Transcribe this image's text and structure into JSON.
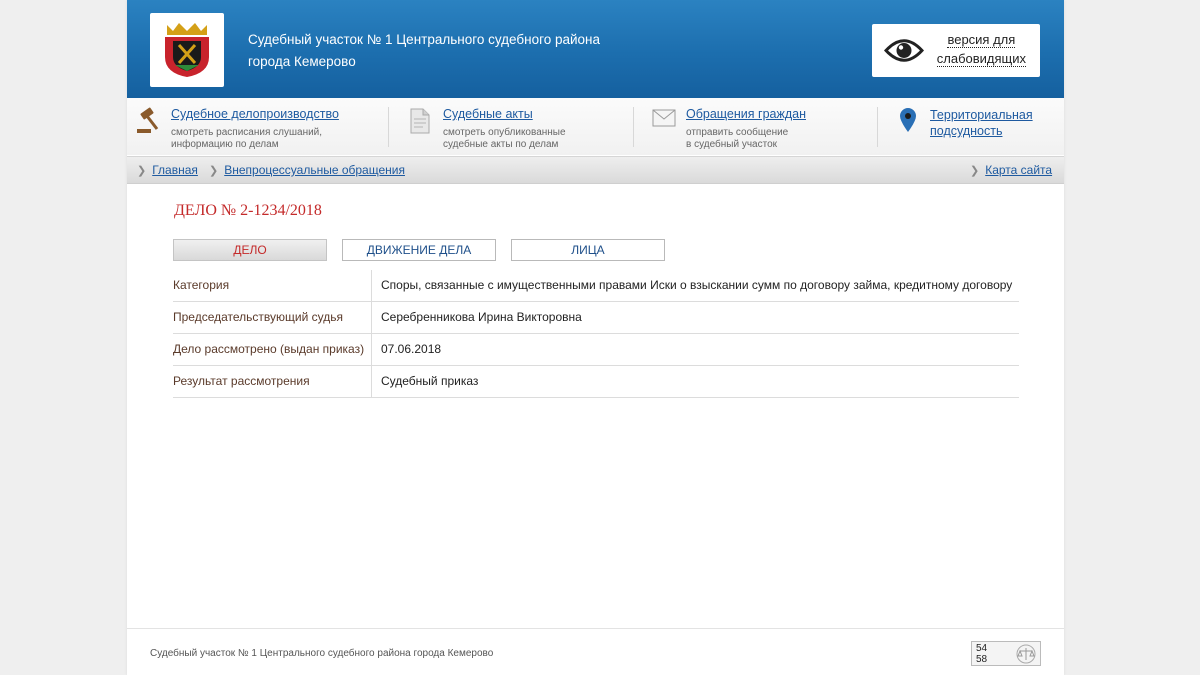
{
  "header": {
    "title_line1": "Судебный участок № 1 Центрального судебного района",
    "title_line2": "города Кемерово",
    "vision_line1": "версия для",
    "vision_line2": "слабовидящих"
  },
  "nav": [
    {
      "label": "Судебное делопроизводство",
      "desc1": "смотреть расписания слушаний,",
      "desc2": "информацию по делам",
      "icon": "gavel-icon"
    },
    {
      "label": "Судебные акты",
      "desc1": "смотреть опубликованные",
      "desc2": "судебные акты по делам",
      "icon": "document-icon"
    },
    {
      "label": "Обращения граждан",
      "desc1": "отправить сообщение",
      "desc2": "в судебный участок",
      "icon": "envelope-icon"
    },
    {
      "label1": "Территориальная",
      "label2": "подсудность",
      "icon": "map-pin-icon"
    }
  ],
  "breadcrumbs": {
    "items": [
      "Главная",
      "Внепроцессуальные обращения"
    ],
    "sitemap": "Карта сайта"
  },
  "case": {
    "title": "ДЕЛО № 2-1234/2018",
    "tabs": [
      "ДЕЛО",
      "ДВИЖЕНИЕ ДЕЛА",
      "ЛИЦА"
    ],
    "active_tab": "ДЕЛО",
    "rows": [
      {
        "key": "Категория",
        "value": "Споры, связанные с имущественными правами Иски о взыскании сумм по договору займа, кредитному договору"
      },
      {
        "key": "Председательствующий судья",
        "value": "Серебренникова Ирина Викторовна"
      },
      {
        "key": "Дело рассмотрено (выдан приказ)",
        "value": "07.06.2018"
      },
      {
        "key": "Результат рассмотрения",
        "value": "Судебный приказ"
      }
    ]
  },
  "footer": {
    "text": "Судебный участок № 1 Центрального судебного района города Кемерово",
    "counter_top": "54",
    "counter_bottom": "58"
  },
  "colors": {
    "header_blue": "#1c6eae",
    "link_blue": "#1e5aa0",
    "accent_red": "#c42a2a"
  }
}
